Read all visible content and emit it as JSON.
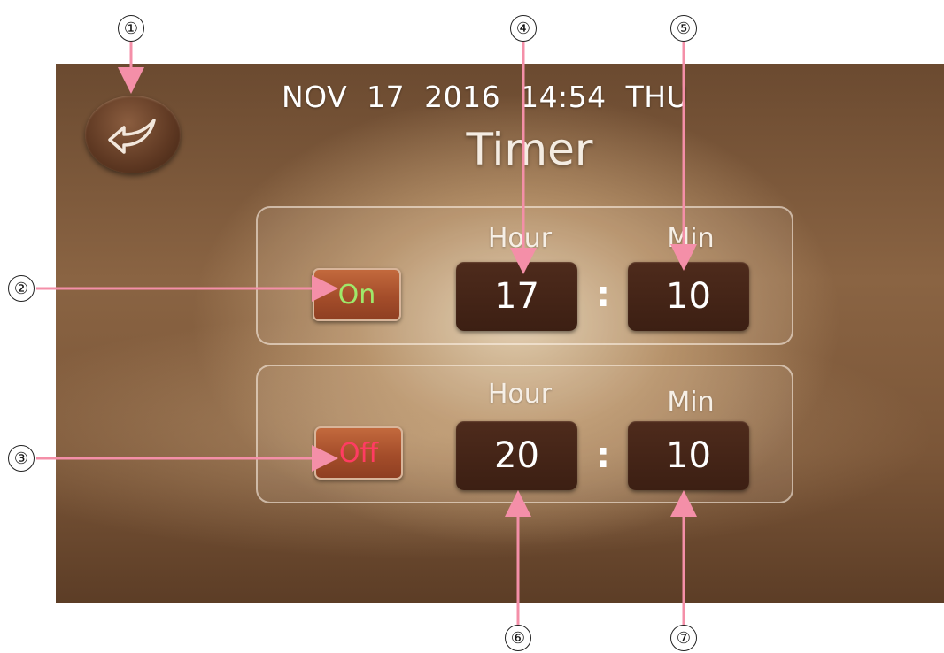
{
  "header": {
    "datetime": "NOV  17  2016  14:54  THU",
    "title": "Timer"
  },
  "back_button": {
    "icon": "back-arrow-icon"
  },
  "timer_on": {
    "toggle_label": "On",
    "hour_label": "Hour",
    "min_label": "Min",
    "hour": "17",
    "minute": "10",
    "separator": ":"
  },
  "timer_off": {
    "toggle_label": "Off",
    "hour_label": "Hour",
    "min_label": "Min",
    "hour": "20",
    "minute": "10",
    "separator": ":"
  },
  "callouts": [
    "①",
    "②",
    "③",
    "④",
    "⑤",
    "⑥",
    "⑦"
  ],
  "colors": {
    "on_text": "#9fe86a",
    "off_text": "#ff3c62",
    "callout_arrow": "#f48fa8",
    "time_box": "#3c1f13",
    "toggle_bg": "#a44d2a"
  }
}
